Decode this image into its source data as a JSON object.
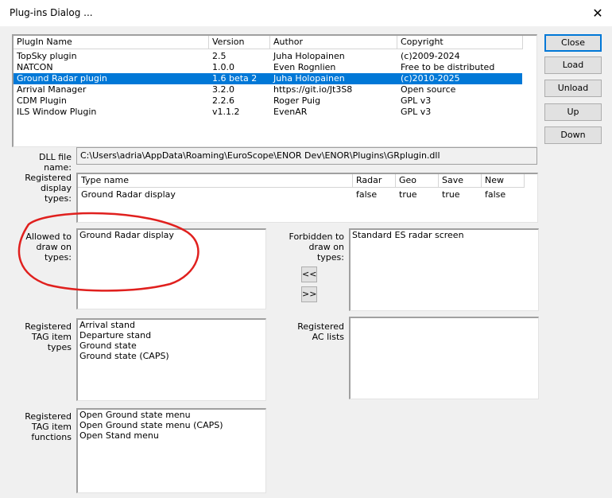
{
  "window": {
    "title": "Plug-ins Dialog ...",
    "close_glyph": "✕"
  },
  "plugins": {
    "columns": [
      "PlugIn Name",
      "Version",
      "Author",
      "Copyright"
    ],
    "rows": [
      {
        "name": "TopSky plugin",
        "version": "2.5",
        "author": "Juha Holopainen",
        "copyright": "(c)2009-2024"
      },
      {
        "name": "NATCON",
        "version": "1.0.0",
        "author": "Even Rognlien",
        "copyright": "Free to be distributed"
      },
      {
        "name": "Ground Radar plugin",
        "version": "1.6 beta 2",
        "author": "Juha Holopainen",
        "copyright": "(c)2010-2025"
      },
      {
        "name": "Arrival Manager",
        "version": "3.2.0",
        "author": "https://git.io/Jt3S8",
        "copyright": "Open source"
      },
      {
        "name": "CDM Plugin",
        "version": "2.2.6",
        "author": "Roger Puig",
        "copyright": "GPL v3"
      },
      {
        "name": "ILS Window Plugin",
        "version": "v1.1.2",
        "author": "EvenAR",
        "copyright": "GPL v3"
      }
    ],
    "selected_index": 2
  },
  "buttons": {
    "close": "Close",
    "load": "Load",
    "unload": "Unload",
    "up": "Up",
    "down": "Down"
  },
  "dll": {
    "label": "DLL file name:",
    "value": "C:\\Users\\adria\\AppData\\Roaming\\EuroScope\\ENOR Dev\\ENOR\\Plugins\\GRplugin.dll"
  },
  "display_types": {
    "label_lines": [
      "Registered",
      "display",
      "types:"
    ],
    "columns": [
      "Type name",
      "Radar",
      "Geo",
      "Save",
      "New"
    ],
    "rows": [
      {
        "name": "Ground Radar display",
        "radar": "false",
        "geo": "true",
        "save": "true",
        "new": "false"
      }
    ]
  },
  "allowed": {
    "label_lines": [
      "Allowed to",
      "draw on",
      "types:"
    ],
    "items": [
      "Ground Radar display"
    ]
  },
  "forbidden": {
    "label_lines": [
      "Forbidden to",
      "draw on",
      "types:"
    ],
    "items": [
      "Standard ES radar screen"
    ]
  },
  "move_buttons": {
    "left": "<<",
    "right": ">>"
  },
  "tag_items": {
    "label_lines": [
      "Registered",
      "TAG item",
      "types"
    ],
    "items": [
      "Arrival stand",
      "Departure stand",
      "Ground state",
      "Ground state (CAPS)"
    ]
  },
  "ac_lists": {
    "label_lines": [
      "Registered",
      "AC lists"
    ],
    "items": []
  },
  "tag_functions": {
    "label_lines": [
      "Registered",
      "TAG item",
      "functions"
    ],
    "items": [
      "Open Ground state menu",
      "Open Ground state menu (CAPS)",
      "Open Stand menu"
    ]
  },
  "annotation": {
    "color": "#e0201e"
  }
}
